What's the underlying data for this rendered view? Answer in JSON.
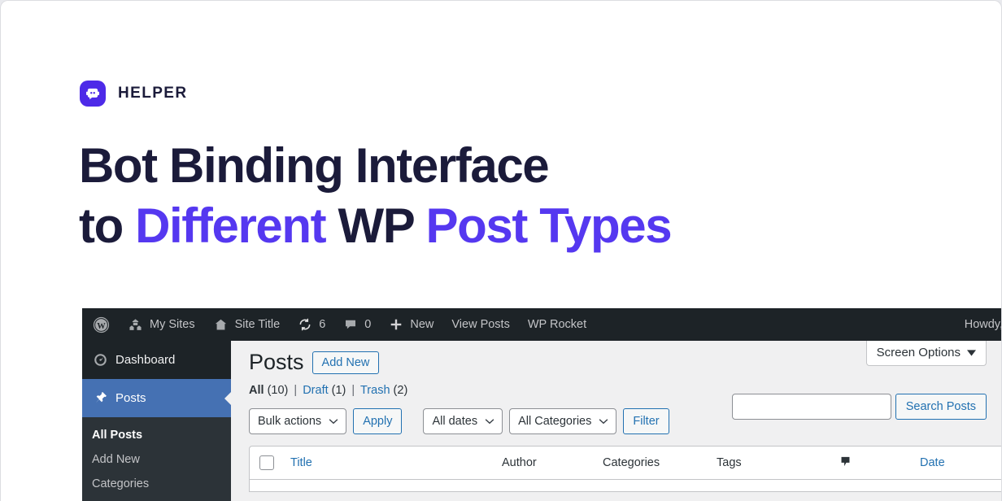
{
  "brand": {
    "name": "HELPER",
    "icon": "bot-chat-icon",
    "mark_color": "#4d2ae8"
  },
  "hero": {
    "line1": "Bot Binding Interface",
    "line2_part1": "to ",
    "line2_accent1": "Different",
    "line2_part2": " WP ",
    "line2_accent2": "Post Types",
    "text_color": "#1b1b3a",
    "accent_color": "#5538f0"
  },
  "wp": {
    "adminbar": {
      "wp_logo": "wordpress-icon",
      "my_sites": {
        "label": "My Sites",
        "icon": "multisite-icon"
      },
      "site_title": {
        "label": "Site Title",
        "icon": "home-icon"
      },
      "updates": {
        "count": "6",
        "icon": "update-icon"
      },
      "comments": {
        "count": "0",
        "icon": "comment-icon"
      },
      "new": {
        "label": "New",
        "icon": "plus-icon"
      },
      "view_posts": {
        "label": "View Posts"
      },
      "wp_rocket": {
        "label": "WP Rocket"
      },
      "howdy": {
        "label": "Howdy,"
      }
    },
    "sidebar": {
      "items": [
        {
          "label": "Dashboard",
          "icon": "dashboard-gauge-icon",
          "current": false
        },
        {
          "label": "Posts",
          "icon": "pushpin-icon",
          "current": true
        }
      ],
      "submenu": [
        {
          "label": "All Posts",
          "current": true
        },
        {
          "label": "Add New",
          "current": false
        },
        {
          "label": "Categories",
          "current": false
        }
      ],
      "active_color": "#4571b3"
    },
    "content": {
      "screen_options": {
        "label": "Screen Options",
        "caret": "chevron-down-icon"
      },
      "page_title": "Posts",
      "add_new_button": "Add New",
      "status_links": [
        {
          "label": "All",
          "count": "(10)",
          "current": true
        },
        {
          "label": "Draft",
          "count": "(1)",
          "current": false
        },
        {
          "label": "Trash",
          "count": "(2)",
          "current": false
        }
      ],
      "status_separator": "|",
      "search": {
        "value": "",
        "placeholder": "",
        "button": "Search Posts"
      },
      "tablenav": {
        "bulk_actions": "Bulk actions",
        "apply_button": "Apply",
        "all_dates": "All dates",
        "all_categories": "All Categories",
        "filter_button": "Filter"
      },
      "table_headers": {
        "title": "Title",
        "author": "Author",
        "categories": "Categories",
        "tags": "Tags",
        "comments_icon": "comment-icon",
        "date": "Date"
      }
    }
  }
}
